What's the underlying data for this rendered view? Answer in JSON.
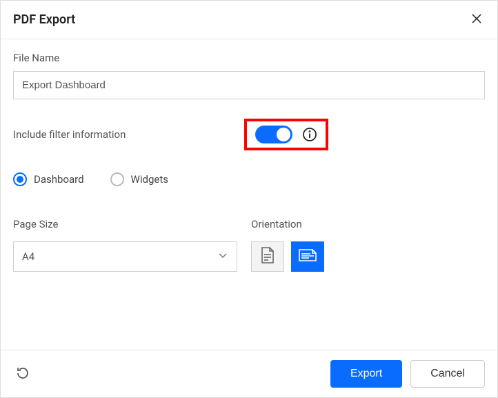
{
  "header": {
    "title": "PDF Export"
  },
  "filename": {
    "label": "File Name",
    "value": "Export Dashboard"
  },
  "filter": {
    "label": "Include filter information",
    "enabled": true
  },
  "viewMode": {
    "options": [
      {
        "label": "Dashboard",
        "selected": true
      },
      {
        "label": "Widgets",
        "selected": false
      }
    ]
  },
  "pageSize": {
    "label": "Page Size",
    "value": "A4"
  },
  "orientation": {
    "label": "Orientation",
    "selected": "landscape"
  },
  "footer": {
    "export": "Export",
    "cancel": "Cancel"
  }
}
